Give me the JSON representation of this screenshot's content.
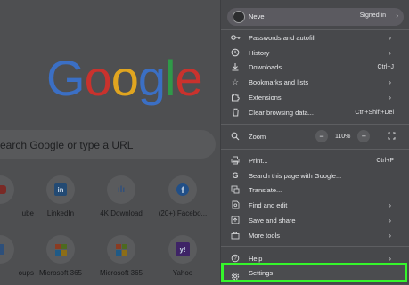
{
  "ntp": {
    "logo_letters": [
      "G",
      "o",
      "o",
      "g",
      "l",
      "e"
    ],
    "logo_colors": [
      "#3b6fc4",
      "#c9322d",
      "#e0a520",
      "#3b6fc4",
      "#2f9a48",
      "#c9322d"
    ],
    "search_placeholder": "earch Google or type a URL",
    "tiles_row1": [
      {
        "label": "ube",
        "icon": "youtube-icon"
      },
      {
        "label": "LinkedIn",
        "icon": "linkedin-icon"
      },
      {
        "label": "4K Download",
        "icon": "4k-download-icon"
      },
      {
        "label": "(20+) Facebo...",
        "icon": "facebook-icon"
      }
    ],
    "tiles_row2": [
      {
        "label": "oups",
        "icon": "groups-icon"
      },
      {
        "label": "Microsoft 365",
        "icon": "microsoft-365-icon"
      },
      {
        "label": "Microsoft 365",
        "icon": "microsoft-365-icon"
      },
      {
        "label": "Yahoo",
        "icon": "yahoo-icon"
      }
    ],
    "tile_glyphs": {
      "linkedin": "in",
      "fourk": "ılı",
      "facebook": "f",
      "yahoo": "y!"
    }
  },
  "menu": {
    "profile": {
      "name": "Neve",
      "status": "Signed in"
    },
    "items": {
      "passwords": "Passwords and autofill",
      "history": "History",
      "downloads": "Downloads",
      "downloads_shortcut": "Ctrl+J",
      "bookmarks": "Bookmarks and lists",
      "extensions": "Extensions",
      "clear": "Clear browsing data...",
      "clear_shortcut": "Ctrl+Shift+Del",
      "zoom": "Zoom",
      "zoom_minus": "−",
      "zoom_value": "110%",
      "zoom_plus": "+",
      "print": "Print...",
      "print_shortcut": "Ctrl+P",
      "search_page": "Search this page with Google...",
      "translate": "Translate...",
      "find": "Find and edit",
      "save": "Save and share",
      "more_tools": "More tools",
      "help": "Help",
      "settings": "Settings"
    },
    "chevron": "›",
    "highlight_color": "#35f52b"
  }
}
